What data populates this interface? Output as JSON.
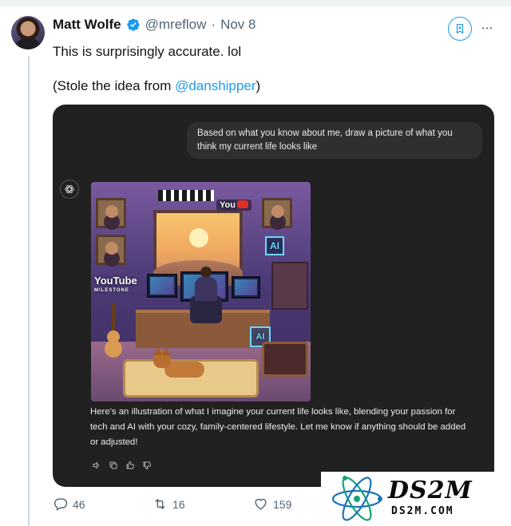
{
  "tweet": {
    "author_name": "Matt Wolfe",
    "handle": "@mreflow",
    "separator": "·",
    "date": "Nov 8",
    "text_line1": "This is surprisingly accurate. lol",
    "text_line2_prefix": "(Stole the idea from ",
    "mention": "@danshipper",
    "text_line2_suffix": ")",
    "more_label": "•••"
  },
  "chat": {
    "user_prompt": "Based on what you know about me, draw a picture of what you think my current life looks like",
    "assistant_reply": "Here's an illustration of what I imagine your current life looks like, blending your passion for tech and AI with your cozy, family-centered lifestyle. Let me know if anything should be added or adjusted!",
    "image_labels": {
      "youtube_sign": "You",
      "youtube_milestone_title": "YouTube",
      "youtube_milestone_sub": "MILESTONE",
      "ai_sign_1": "AI",
      "ai_sign_2": "AI"
    }
  },
  "stats": {
    "replies": "46",
    "retweets": "16",
    "likes": "159"
  },
  "watermark": {
    "title": "DS2M",
    "subtitle": "DS2M.COM"
  },
  "colors": {
    "accent": "#1d9bf0",
    "text_primary": "#0f1419",
    "text_secondary": "#536471",
    "card_bg": "#212121",
    "bubble_bg": "#2f2f2f"
  },
  "icons": {
    "verified": "verified-badge-icon",
    "bookmark": "bookmark-icon",
    "more": "more-dots-icon",
    "reply": "reply-icon",
    "retweet": "retweet-icon",
    "like": "heart-icon",
    "gpt": "openai-logo-icon"
  }
}
